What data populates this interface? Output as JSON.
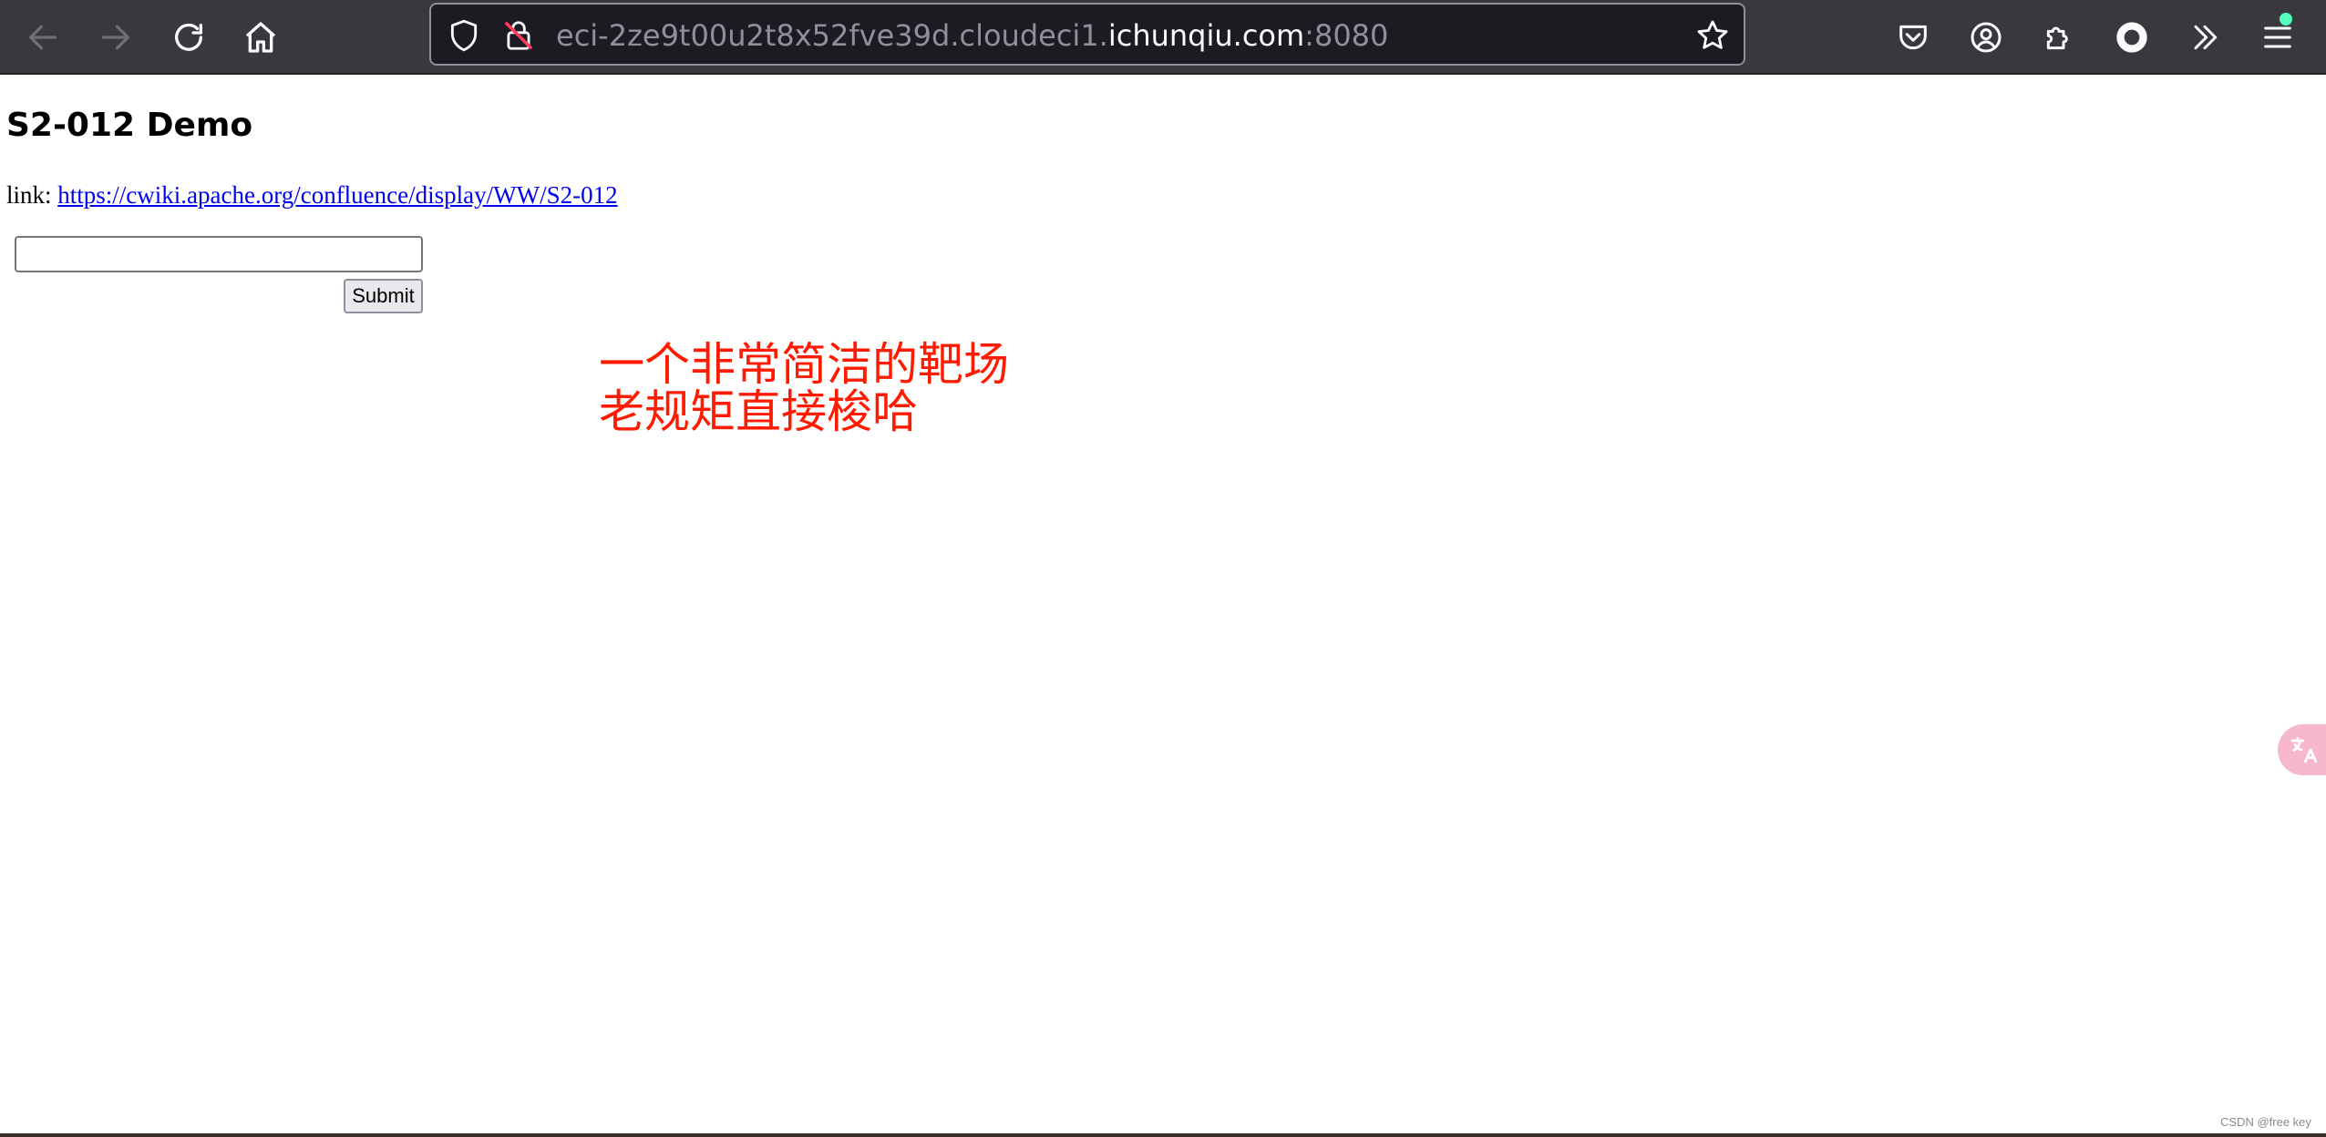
{
  "browser": {
    "url_prefix": "eci-2ze9t00u2t8x52fve39d.cloudeci1.",
    "url_host": "ichunqiu.com",
    "url_port": ":8080"
  },
  "page": {
    "title": "S2-012 Demo",
    "link_label": "link: ",
    "link_url": "https://cwiki.apache.org/confluence/display/WW/S2-012",
    "input_value": "",
    "submit_label": "Submit"
  },
  "annotation": {
    "line1": "一个非常简洁的靶场",
    "line2": "老规矩直接梭哈"
  },
  "watermark": "CSDN @free key",
  "colors": {
    "toolbar_bg": "#38383d",
    "urlbar_bg": "#1c1b22",
    "link": "#0000ee",
    "annotation": "#ff1a00"
  }
}
